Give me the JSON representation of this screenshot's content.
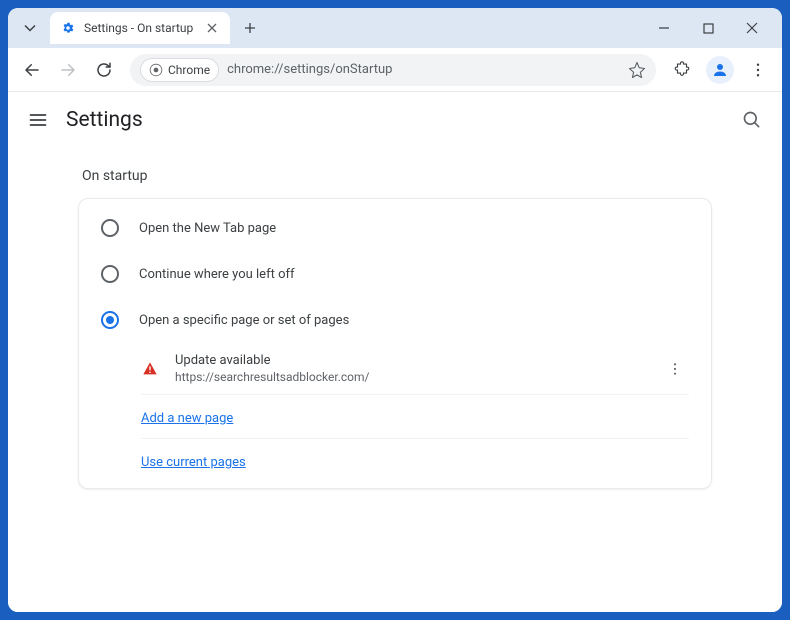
{
  "window": {
    "tab_title": "Settings - On startup",
    "omnibox": {
      "chip_label": "Chrome",
      "url": "chrome://settings/onStartup"
    }
  },
  "page": {
    "title": "Settings",
    "section_title": "On startup",
    "options": [
      {
        "label": "Open the New Tab page",
        "selected": false
      },
      {
        "label": "Continue where you left off",
        "selected": false
      },
      {
        "label": "Open a specific page or set of pages",
        "selected": true
      }
    ],
    "startup_pages": [
      {
        "title": "Update available",
        "url": "https://searchresultsadblocker.com/"
      }
    ],
    "add_page_label": "Add a new page",
    "use_current_label": "Use current pages"
  }
}
